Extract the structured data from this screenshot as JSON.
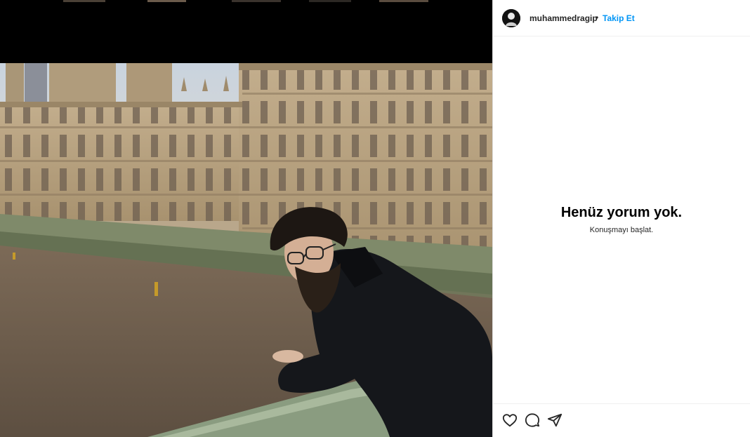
{
  "post": {
    "username": "muhammedragip",
    "separator": "•",
    "follow_label": "Takip Et"
  },
  "comments": {
    "empty_title": "Henüz yorum yok.",
    "empty_subtitle": "Konuşmayı başlat."
  },
  "actions": [
    {
      "icon": "heart-icon",
      "label": "like"
    },
    {
      "icon": "comment-icon",
      "label": "comment"
    },
    {
      "icon": "share-icon",
      "label": "share"
    }
  ],
  "colors": {
    "accent": "#0095f6",
    "text": "#262626",
    "divider": "#efefef"
  }
}
